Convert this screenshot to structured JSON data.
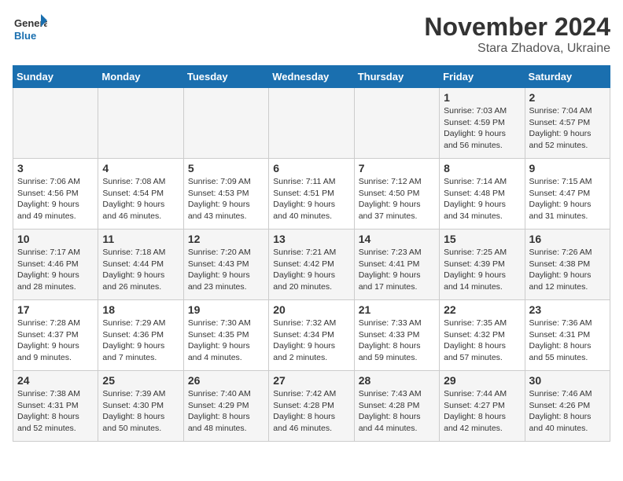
{
  "logo": {
    "line1": "General",
    "line2": "Blue"
  },
  "title": "November 2024",
  "subtitle": "Stara Zhadova, Ukraine",
  "weekdays": [
    "Sunday",
    "Monday",
    "Tuesday",
    "Wednesday",
    "Thursday",
    "Friday",
    "Saturday"
  ],
  "weeks": [
    [
      {
        "day": "",
        "info": ""
      },
      {
        "day": "",
        "info": ""
      },
      {
        "day": "",
        "info": ""
      },
      {
        "day": "",
        "info": ""
      },
      {
        "day": "",
        "info": ""
      },
      {
        "day": "1",
        "info": "Sunrise: 7:03 AM\nSunset: 4:59 PM\nDaylight: 9 hours and 56 minutes."
      },
      {
        "day": "2",
        "info": "Sunrise: 7:04 AM\nSunset: 4:57 PM\nDaylight: 9 hours and 52 minutes."
      }
    ],
    [
      {
        "day": "3",
        "info": "Sunrise: 7:06 AM\nSunset: 4:56 PM\nDaylight: 9 hours and 49 minutes."
      },
      {
        "day": "4",
        "info": "Sunrise: 7:08 AM\nSunset: 4:54 PM\nDaylight: 9 hours and 46 minutes."
      },
      {
        "day": "5",
        "info": "Sunrise: 7:09 AM\nSunset: 4:53 PM\nDaylight: 9 hours and 43 minutes."
      },
      {
        "day": "6",
        "info": "Sunrise: 7:11 AM\nSunset: 4:51 PM\nDaylight: 9 hours and 40 minutes."
      },
      {
        "day": "7",
        "info": "Sunrise: 7:12 AM\nSunset: 4:50 PM\nDaylight: 9 hours and 37 minutes."
      },
      {
        "day": "8",
        "info": "Sunrise: 7:14 AM\nSunset: 4:48 PM\nDaylight: 9 hours and 34 minutes."
      },
      {
        "day": "9",
        "info": "Sunrise: 7:15 AM\nSunset: 4:47 PM\nDaylight: 9 hours and 31 minutes."
      }
    ],
    [
      {
        "day": "10",
        "info": "Sunrise: 7:17 AM\nSunset: 4:46 PM\nDaylight: 9 hours and 28 minutes."
      },
      {
        "day": "11",
        "info": "Sunrise: 7:18 AM\nSunset: 4:44 PM\nDaylight: 9 hours and 26 minutes."
      },
      {
        "day": "12",
        "info": "Sunrise: 7:20 AM\nSunset: 4:43 PM\nDaylight: 9 hours and 23 minutes."
      },
      {
        "day": "13",
        "info": "Sunrise: 7:21 AM\nSunset: 4:42 PM\nDaylight: 9 hours and 20 minutes."
      },
      {
        "day": "14",
        "info": "Sunrise: 7:23 AM\nSunset: 4:41 PM\nDaylight: 9 hours and 17 minutes."
      },
      {
        "day": "15",
        "info": "Sunrise: 7:25 AM\nSunset: 4:39 PM\nDaylight: 9 hours and 14 minutes."
      },
      {
        "day": "16",
        "info": "Sunrise: 7:26 AM\nSunset: 4:38 PM\nDaylight: 9 hours and 12 minutes."
      }
    ],
    [
      {
        "day": "17",
        "info": "Sunrise: 7:28 AM\nSunset: 4:37 PM\nDaylight: 9 hours and 9 minutes."
      },
      {
        "day": "18",
        "info": "Sunrise: 7:29 AM\nSunset: 4:36 PM\nDaylight: 9 hours and 7 minutes."
      },
      {
        "day": "19",
        "info": "Sunrise: 7:30 AM\nSunset: 4:35 PM\nDaylight: 9 hours and 4 minutes."
      },
      {
        "day": "20",
        "info": "Sunrise: 7:32 AM\nSunset: 4:34 PM\nDaylight: 9 hours and 2 minutes."
      },
      {
        "day": "21",
        "info": "Sunrise: 7:33 AM\nSunset: 4:33 PM\nDaylight: 8 hours and 59 minutes."
      },
      {
        "day": "22",
        "info": "Sunrise: 7:35 AM\nSunset: 4:32 PM\nDaylight: 8 hours and 57 minutes."
      },
      {
        "day": "23",
        "info": "Sunrise: 7:36 AM\nSunset: 4:31 PM\nDaylight: 8 hours and 55 minutes."
      }
    ],
    [
      {
        "day": "24",
        "info": "Sunrise: 7:38 AM\nSunset: 4:31 PM\nDaylight: 8 hours and 52 minutes."
      },
      {
        "day": "25",
        "info": "Sunrise: 7:39 AM\nSunset: 4:30 PM\nDaylight: 8 hours and 50 minutes."
      },
      {
        "day": "26",
        "info": "Sunrise: 7:40 AM\nSunset: 4:29 PM\nDaylight: 8 hours and 48 minutes."
      },
      {
        "day": "27",
        "info": "Sunrise: 7:42 AM\nSunset: 4:28 PM\nDaylight: 8 hours and 46 minutes."
      },
      {
        "day": "28",
        "info": "Sunrise: 7:43 AM\nSunset: 4:28 PM\nDaylight: 8 hours and 44 minutes."
      },
      {
        "day": "29",
        "info": "Sunrise: 7:44 AM\nSunset: 4:27 PM\nDaylight: 8 hours and 42 minutes."
      },
      {
        "day": "30",
        "info": "Sunrise: 7:46 AM\nSunset: 4:26 PM\nDaylight: 8 hours and 40 minutes."
      }
    ]
  ]
}
